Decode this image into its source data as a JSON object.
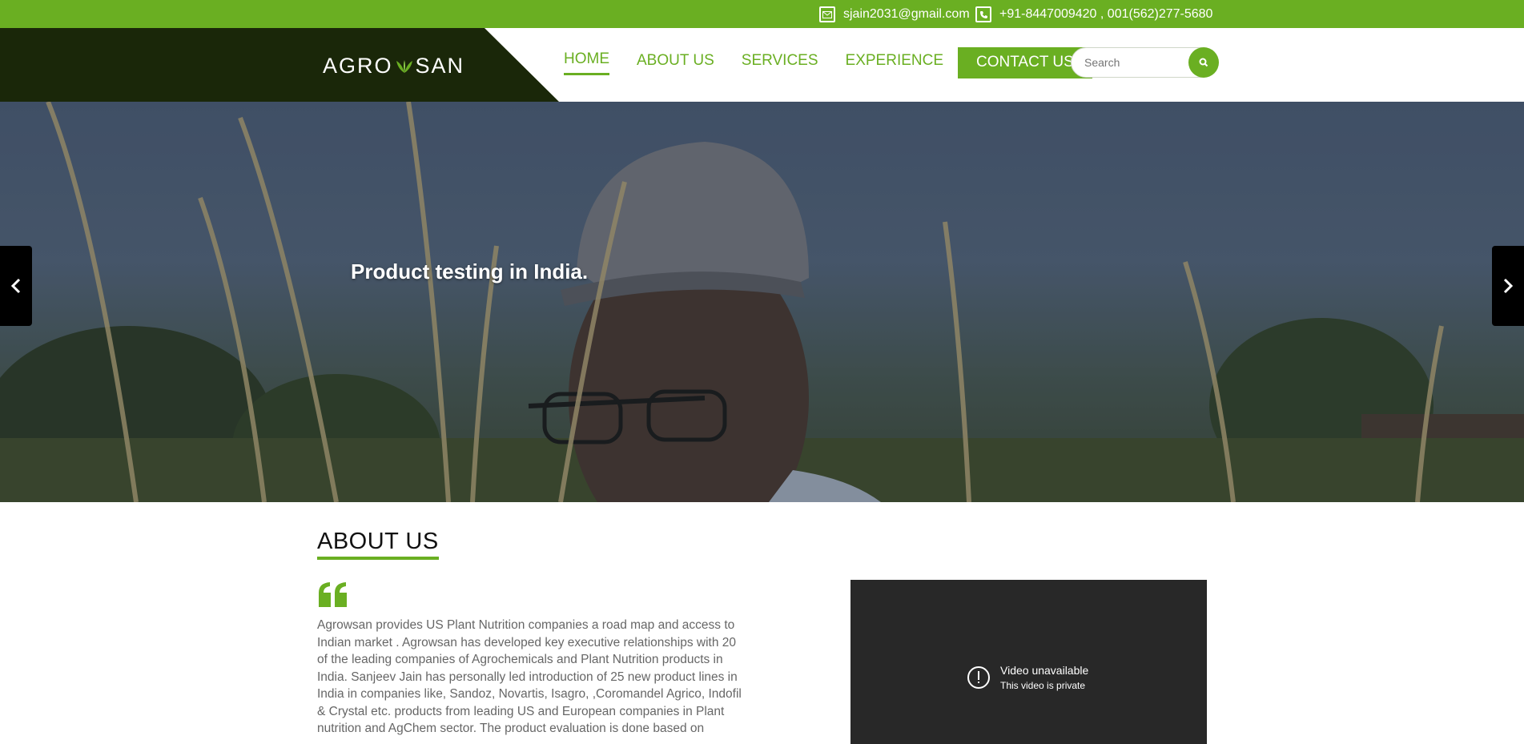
{
  "topbar": {
    "email": "sjain2031@gmail.com",
    "phone": "+91-8447009420 , 001(562)277-5680",
    "email_icon": "envelope-icon",
    "phone_icon": "phone-icon"
  },
  "header": {
    "logo_left": "AGRO",
    "logo_right": "SAN",
    "nav": [
      {
        "label": "HOME",
        "active": true
      },
      {
        "label": "ABOUT US"
      },
      {
        "label": "SERVICES"
      },
      {
        "label": "EXPERIENCE"
      }
    ],
    "contact_button": "CONTACT US",
    "search_placeholder": "Search"
  },
  "hero": {
    "caption": "Product testing in India."
  },
  "about": {
    "title": "ABOUT US",
    "body": "Agrowsan provides US Plant Nutrition companies a road map and access to Indian market . Agrowsan has developed key executive relationships with 20 of the leading companies of Agrochemicals and Plant Nutrition products in India. Sanjeev Jain has personally led introduction of 25 new product lines in India in companies like, Sandoz, Novartis, Isagro, ,Coromandel Agrico, Indofil & Crystal etc. products from leading US and European companies in Plant nutrition and AgChem sector. The product evaluation is done based on"
  },
  "video": {
    "title": "Video unavailable",
    "subtitle": "This video is private"
  },
  "colors": {
    "brand_green": "#6aaf22",
    "logo_panel": "#1a2709"
  }
}
